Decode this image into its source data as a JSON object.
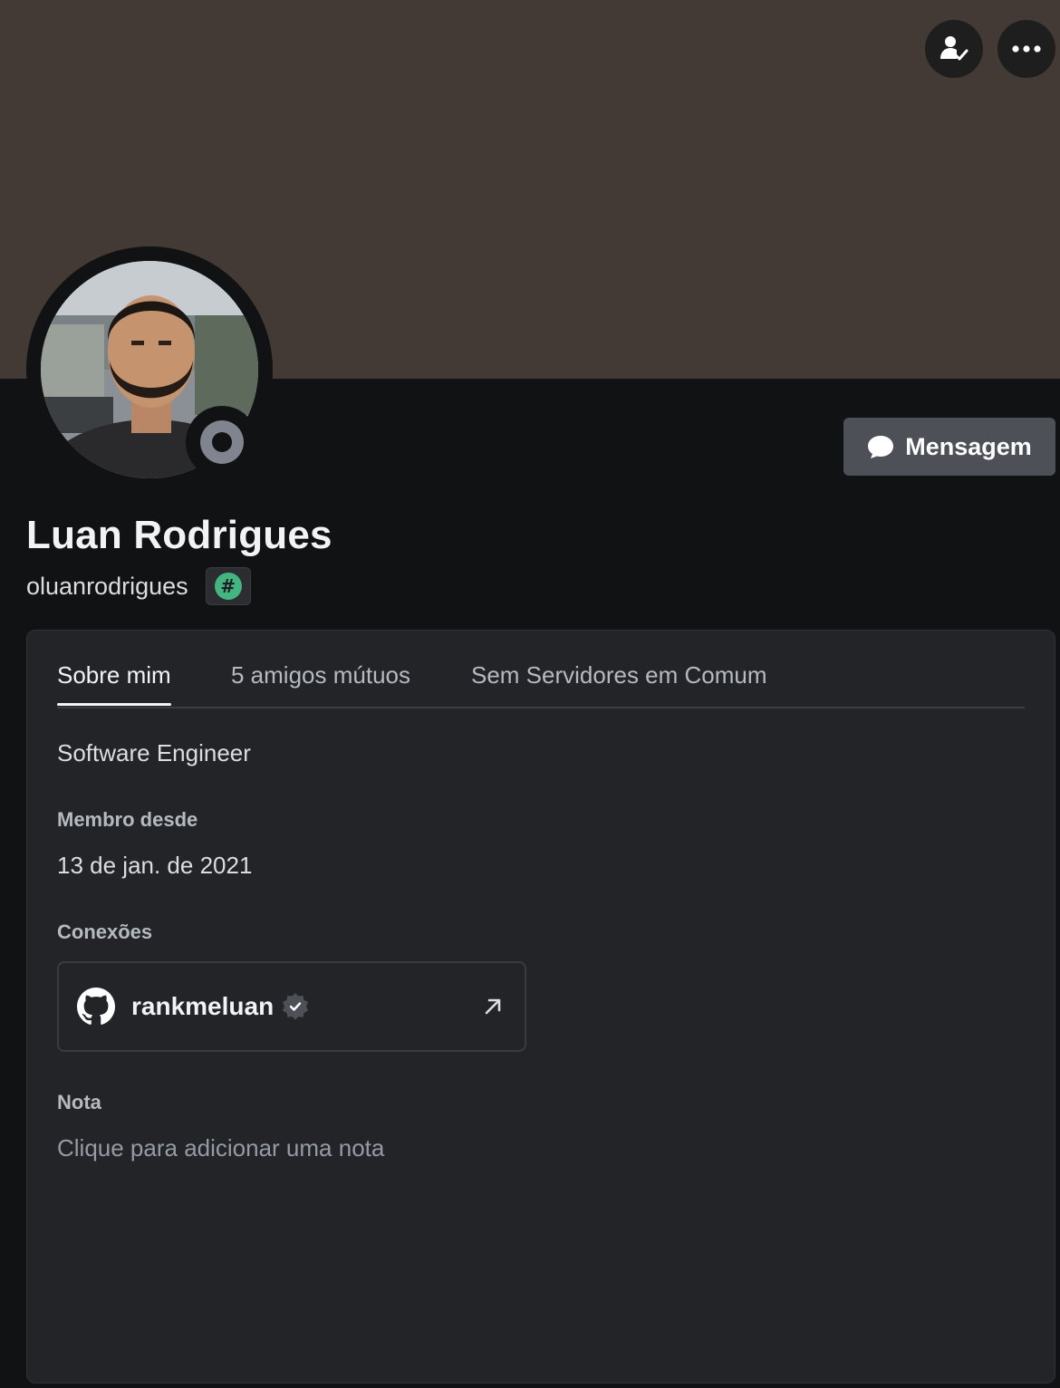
{
  "colors": {
    "banner": "#433a35",
    "background": "#111214",
    "card": "#232428",
    "message_button": "#4e5058",
    "status_offline": "#80848e",
    "tag_badge": "#43b581"
  },
  "header": {
    "add_friend_icon": "person-check-icon",
    "more_icon": "ellipsis-icon"
  },
  "profile": {
    "display_name": "Luan Rodrigues",
    "username": "oluanrodrigues",
    "tag_symbol": "#",
    "status": "offline"
  },
  "actions": {
    "message_label": "Mensagem",
    "message_icon": "chat-bubble-icon"
  },
  "tabs": [
    {
      "label": "Sobre mim",
      "active": true
    },
    {
      "label": "5 amigos mútuos",
      "active": false
    },
    {
      "label": "Sem Servidores em Comum",
      "active": false
    }
  ],
  "about": {
    "bio": "Software Engineer",
    "member_since_label": "Membro desde",
    "member_since_value": "13 de jan. de 2021",
    "connections_label": "Conexões",
    "connections": [
      {
        "service_icon": "github-icon",
        "name": "rankmeluan",
        "verified": true,
        "link_icon": "external-arrow-icon"
      }
    ],
    "note_label": "Nota",
    "note_placeholder": "Clique para adicionar uma nota"
  }
}
